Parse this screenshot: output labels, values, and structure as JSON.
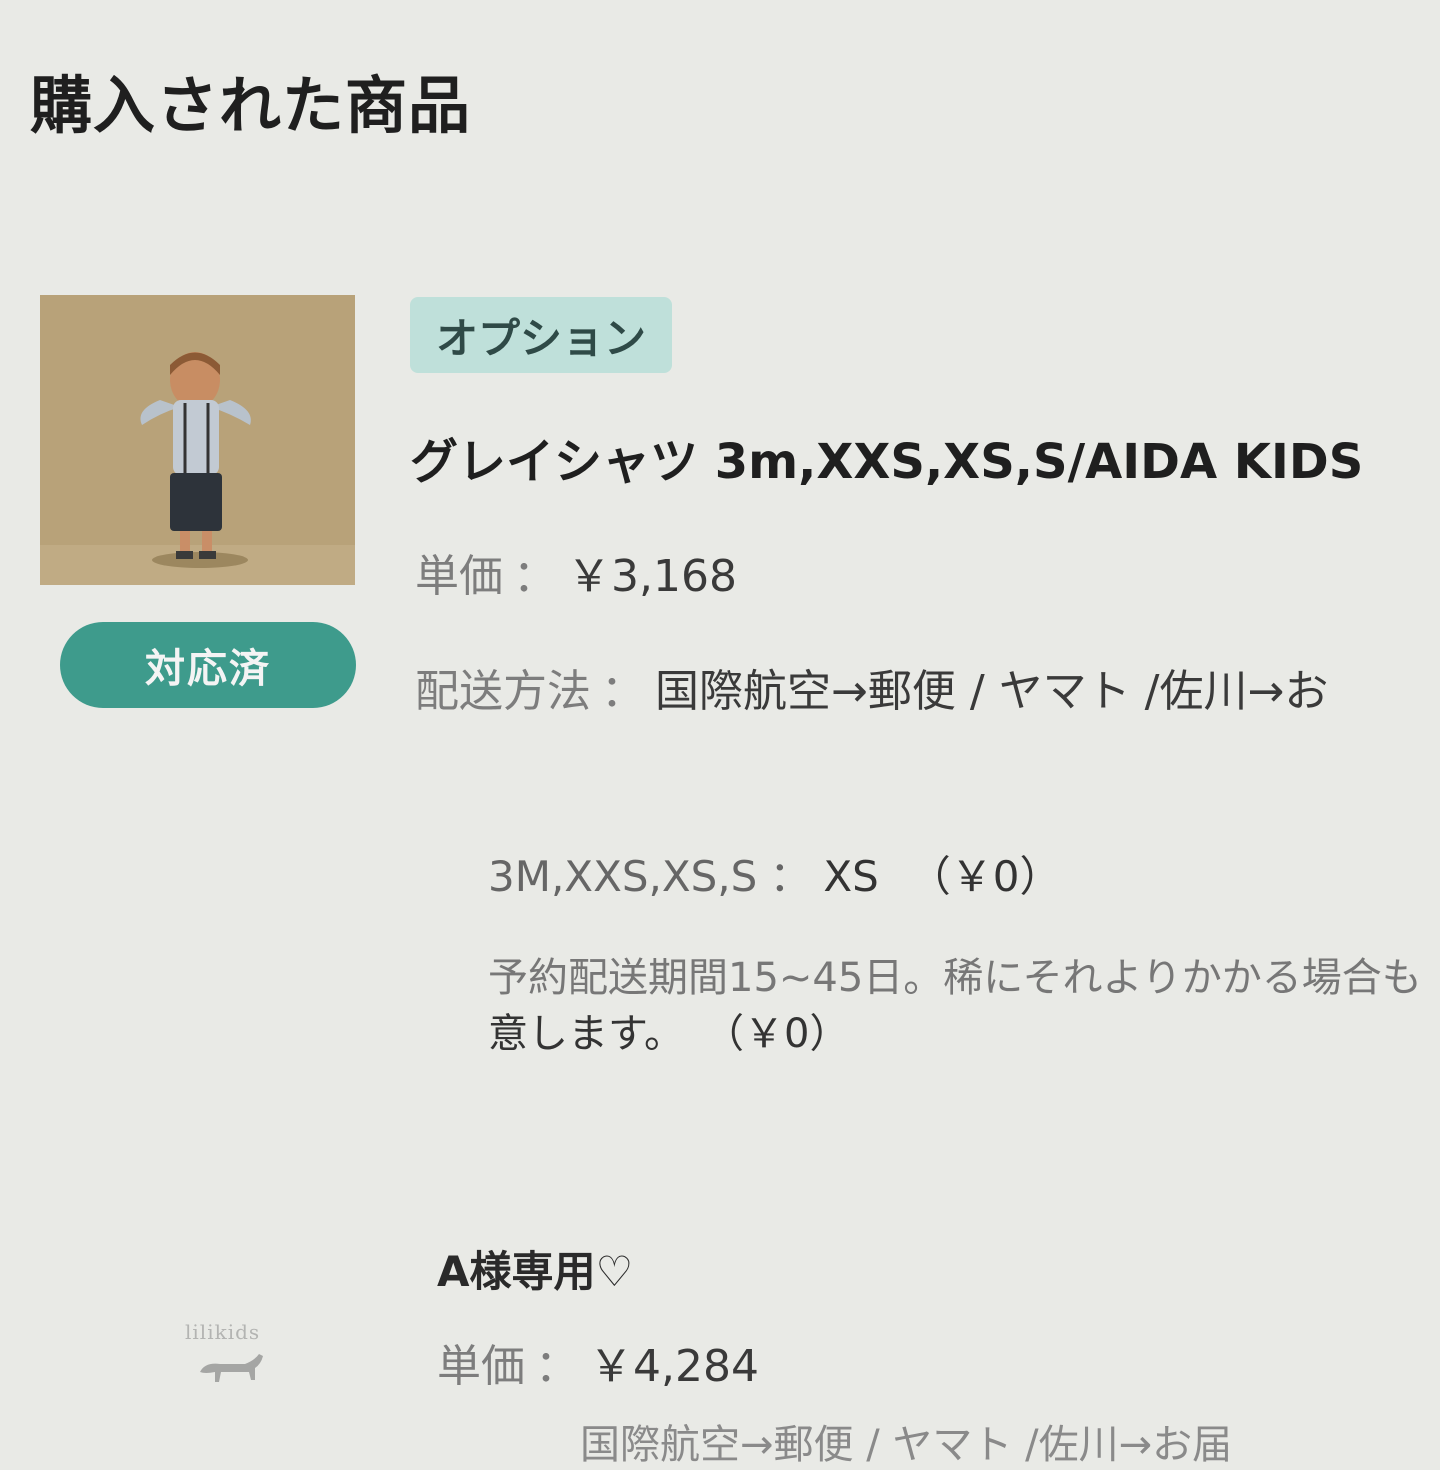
{
  "page": {
    "title": "購入された商品"
  },
  "item1": {
    "status_label": "対応済",
    "tag": "オプション",
    "name": "グレイシャツ 3m,XXS,XS,S/AIDA KIDS",
    "unit_price_label": "単価",
    "unit_price_value": "￥3,168",
    "shipping_label": "配送方法",
    "shipping_value": "国際航空→郵便 / ヤマト /佐川→お",
    "options": [
      {
        "label": "3M,XXS,XS,S",
        "value": "XS",
        "price": "（￥0）"
      }
    ],
    "notes": [
      {
        "text": "予約配送期間15~45日。稀にそれよりかかる場合も",
        "end": "意します。",
        "price": "（￥0）"
      }
    ]
  },
  "item2": {
    "name": "A様専用♡",
    "logo_text": "lilikids",
    "unit_price_label": "単価",
    "unit_price_value": "￥4,284",
    "shipping_value_cut": "国際航空→郵便 / ヤマト /佐川→お届"
  },
  "colors": {
    "background": "#e9eae6",
    "status_badge": "#3e9b8c",
    "option_tag_bg": "#bfe0da",
    "thumbnail_bg": "#b8a279"
  },
  "icons": {
    "item1_thumbnail": "product-photo-child",
    "item2_thumbnail": "brand-logo-dog"
  }
}
